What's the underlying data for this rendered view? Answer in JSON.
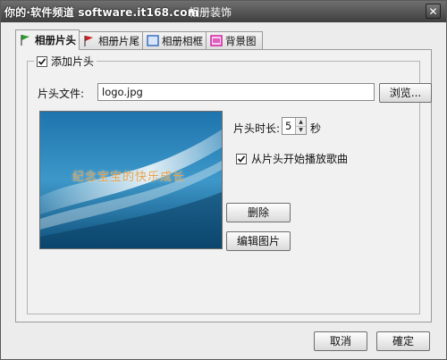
{
  "window": {
    "watermark": "你的·软件频道 software.it168.com",
    "title": "相册装饰",
    "close_symbol": "✕"
  },
  "tabs": [
    {
      "label": "相册片头",
      "icon": "green-flag-icon",
      "active": true,
      "color": "#2e9b2e"
    },
    {
      "label": "相册片尾",
      "icon": "red-flag-icon",
      "active": false,
      "color": "#cc2020"
    },
    {
      "label": "相册相框",
      "icon": "frame-icon",
      "active": false,
      "color": "#3c6fbf"
    },
    {
      "label": "背景图",
      "icon": "picture-icon",
      "active": false,
      "color": "#d020a0"
    }
  ],
  "intro": {
    "enable_label": "添加片头",
    "enabled": true,
    "file_label": "片头文件:",
    "file_value": "logo.jpg",
    "browse_label": "浏览...",
    "preview_text": "纪念宝宝的快乐成长",
    "duration_label": "片头时长:",
    "duration_value": "5",
    "duration_unit": "秒",
    "play_music_label": "从片头开始播放歌曲",
    "play_music_checked": true,
    "delete_label": "删除",
    "edit_label": "编辑图片"
  },
  "footer": {
    "cancel_label": "取消",
    "ok_label": "確定"
  },
  "colors": {
    "titlebar": "#4a4a4a",
    "panel": "#f1f1f1",
    "preview_sky": "#2a7fb5"
  }
}
